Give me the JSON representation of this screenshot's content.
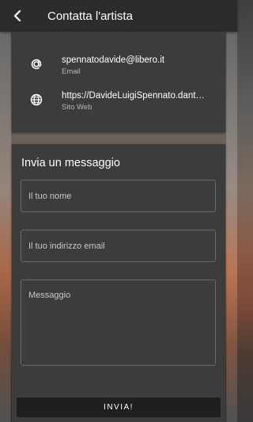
{
  "header": {
    "title": "Contatta l'artista",
    "back_icon": "arrow-left-icon"
  },
  "contacts": [
    {
      "icon": "at-icon",
      "value": "spennatodavide@libero.it",
      "label": "Email"
    },
    {
      "icon": "globe-icon",
      "value": "https://DavideLuigiSpennato.dant…",
      "label": "Sito Web"
    }
  ],
  "form": {
    "title": "Invia un messaggio",
    "name_placeholder": "Il tuo nome",
    "email_placeholder": "Il tuo indirizzo email",
    "message_placeholder": "Messaggio",
    "submit_label": "INVIA!"
  },
  "colors": {
    "header": "#2c2c2c",
    "card": "#3c3c3c",
    "button": "#1f1f1f"
  }
}
